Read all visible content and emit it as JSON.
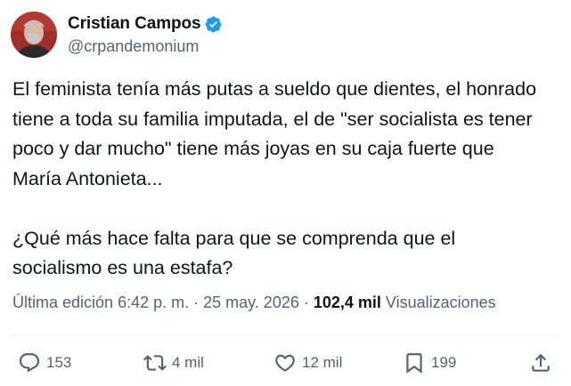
{
  "author": {
    "display_name": "Cristian Campos",
    "handle": "@crpandemonium",
    "verified": true,
    "verified_color": "#1d9bf0"
  },
  "post": {
    "text": "El feminista tenía más putas a sueldo que dientes, el honrado\ntiene a toda su familia imputada, el de \"ser socialista es tener\npoco y dar mucho\" tiene más joyas en su caja fuerte que\nMaría Antonieta...\n\n¿Qué más hace falta para que se comprenda que el\nsocialismo es una estafa?"
  },
  "meta": {
    "edited_label": "Última edición",
    "time": "6:42 p. m.",
    "separator": "·",
    "date": "25 may. 2026",
    "views_count": "102,4 mil",
    "views_label": "Visualizaciones"
  },
  "actions": {
    "replies": {
      "icon": "reply-icon",
      "count": "153"
    },
    "reposts": {
      "icon": "repost-icon",
      "count": "4 mil"
    },
    "likes": {
      "icon": "like-icon",
      "count": "12 mil"
    },
    "bookmarks": {
      "icon": "bookmark-icon",
      "count": "199"
    },
    "share": {
      "icon": "share-icon"
    }
  },
  "colors": {
    "text": "#0f1419",
    "secondary": "#536471",
    "divider": "#eff3f4"
  }
}
